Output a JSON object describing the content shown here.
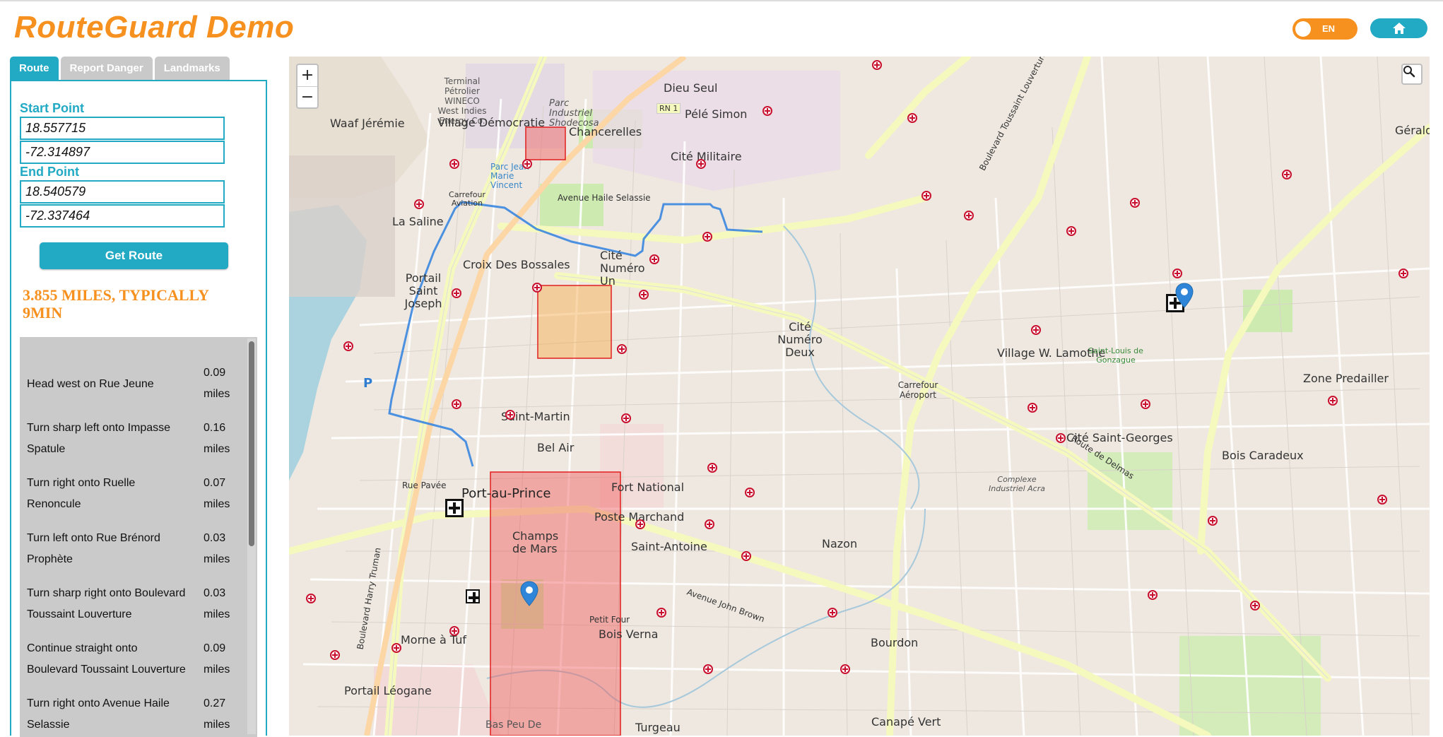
{
  "app": {
    "title": "RouteGuard Demo"
  },
  "header": {
    "language": "EN",
    "home_icon": "home-icon",
    "accent_color": "#f6901e",
    "brand_color": "#22a9c4"
  },
  "tabs": [
    {
      "label": "Route",
      "active": true
    },
    {
      "label": "Report Danger",
      "active": false
    },
    {
      "label": "Landmarks",
      "active": false
    }
  ],
  "route_form": {
    "start_label": "Start Point",
    "start_lat": "18.557715",
    "start_lng": "-72.314897",
    "end_label": "End Point",
    "end_lat": "18.540579",
    "end_lng": "-72.337464",
    "button_label": "Get Route"
  },
  "summary": "3.855 miles, typically 9min",
  "directions": [
    {
      "text": "Head west on Rue Jeune",
      "distance": "0.09 miles"
    },
    {
      "text": "Turn sharp left onto Impasse Spatule",
      "distance": "0.16 miles"
    },
    {
      "text": "Turn right onto Ruelle Renoncule",
      "distance": "0.07 miles"
    },
    {
      "text": "Turn left onto Rue Brénord Prophète",
      "distance": "0.03 miles"
    },
    {
      "text": "Turn sharp right onto Boulevard Toussaint Louverture",
      "distance": "0.03 miles"
    },
    {
      "text": "Continue straight onto Boulevard Toussaint Louverture",
      "distance": "0.09 miles"
    },
    {
      "text": "Turn right onto Avenue Haile Selassie",
      "distance": "0.27 miles"
    }
  ],
  "map": {
    "zoom_in": "+",
    "zoom_out": "−",
    "labels": [
      "Terminal Pétrolier WINECO West Indies Energy Co.",
      "Dieu Seul",
      "Pélé Simon",
      "Parc Industriel Shodecosa",
      "Waaf Jérémie",
      "Village Démocratie",
      "Chancerelles",
      "Cité Militaire",
      "Parc Jean Marie Vincent",
      "Avenue Haile Selassie",
      "Carrefour Aviation",
      "La Saline",
      "Cité Numéro Un",
      "Croix Des Bossales",
      "Portail Saint Joseph",
      "Saint-Martin",
      "Bel Air",
      "Cité Numéro Deux",
      "Fort National",
      "Port-au-Prince",
      "Champs de Mars",
      "Poste Marchand",
      "Saint-Antoine",
      "Nazon",
      "Bois Verna",
      "Morne à Tuf",
      "Portail Léogane",
      "Bourdon",
      "Village W. Lamothe",
      "Carrefour Aéroport",
      "Cité Saint-Georges",
      "Bois Caradeux",
      "Zone Predailler",
      "Gérald Bat",
      "Complexe Industriel Acra",
      "Petit Four",
      "Turgeau",
      "Canapé Vert",
      "Boulevard Toussaint Louverture",
      "Route de Delmas",
      "Avenue John Brown",
      "Boulevard Harry Truman",
      "Rue Pavée",
      "RN 1",
      "Saint-Louis de Gonzague",
      "Bas Peu De"
    ]
  }
}
